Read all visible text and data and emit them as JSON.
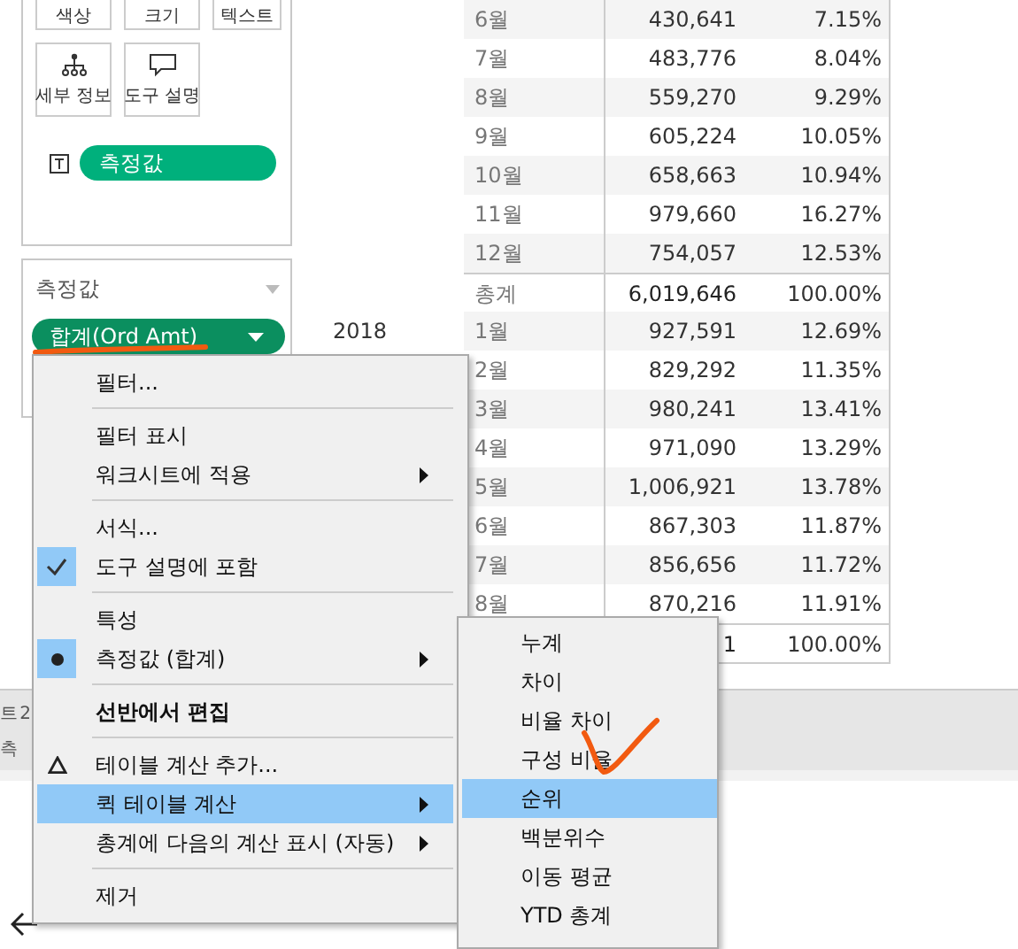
{
  "marks_card": {
    "buttons": [
      {
        "label": "색상",
        "kind": "plain"
      },
      {
        "label": "크기",
        "kind": "plain"
      },
      {
        "label": "텍스트",
        "kind": "plain"
      },
      {
        "label": "세부 정보",
        "kind": "detail"
      },
      {
        "label": "도구 설명",
        "kind": "tooltip"
      }
    ],
    "text_pill": "측정값"
  },
  "measure_values": {
    "title": "측정값",
    "pill": "합계(Ord Amt)"
  },
  "table": {
    "rows": [
      {
        "month": "6월",
        "value": "430,641",
        "percent": "7.15%"
      },
      {
        "month": "7월",
        "value": "483,776",
        "percent": "8.04%"
      },
      {
        "month": "8월",
        "value": "559,270",
        "percent": "9.29%"
      },
      {
        "month": "9월",
        "value": "605,224",
        "percent": "10.05%"
      },
      {
        "month": "10월",
        "value": "658,663",
        "percent": "10.94%"
      },
      {
        "month": "11월",
        "value": "979,660",
        "percent": "16.27%"
      },
      {
        "month": "12월",
        "value": "754,057",
        "percent": "12.53%"
      },
      {
        "month": "총계",
        "value": "6,019,646",
        "percent": "100.00%",
        "total": true
      },
      {
        "year": "2018",
        "month": "1월",
        "value": "927,591",
        "percent": "12.69%"
      },
      {
        "month": "2월",
        "value": "829,292",
        "percent": "11.35%"
      },
      {
        "month": "3월",
        "value": "980,241",
        "percent": "13.41%"
      },
      {
        "month": "4월",
        "value": "971,090",
        "percent": "13.29%"
      },
      {
        "month": "5월",
        "value": "1,006,921",
        "percent": "13.78%"
      },
      {
        "month": "6월",
        "value": "867,303",
        "percent": "11.87%"
      },
      {
        "month": "7월",
        "value": "856,656",
        "percent": "11.72%"
      },
      {
        "month": "8월",
        "value": "870,216",
        "percent": "11.91%"
      },
      {
        "value": "1",
        "percent": "100.00%",
        "total": true
      }
    ]
  },
  "sheet_tabs": [
    "트 2",
    "측"
  ],
  "context_menu": {
    "groups": [
      [
        {
          "label": "필터...",
          "selected": false,
          "submenu": false
        }
      ],
      [
        {
          "label": "필터 표시",
          "selected": false,
          "submenu": false
        },
        {
          "label": "워크시트에 적용",
          "selected": false,
          "submenu": true
        }
      ],
      [
        {
          "label": "서식...",
          "selected": false,
          "submenu": false
        },
        {
          "label": "도구 설명에 포함",
          "selected": false,
          "submenu": false,
          "kind": "check"
        }
      ],
      [
        {
          "label": "특성",
          "selected": false,
          "submenu": false
        },
        {
          "label": "측정값 (합계)",
          "selected": false,
          "submenu": true,
          "kind": "radio"
        }
      ],
      [
        {
          "label": "선반에서 편집",
          "selected": false,
          "submenu": false,
          "bold": true
        }
      ],
      [
        {
          "label": "테이블 계산 추가...",
          "selected": false,
          "submenu": false,
          "kind": "calc"
        },
        {
          "label": "퀵 테이블 계산",
          "selected": true,
          "submenu": true
        },
        {
          "label": "총계에 다음의 계산 표시 (자동)",
          "selected": false,
          "submenu": true
        }
      ],
      [
        {
          "label": "제거",
          "selected": false,
          "submenu": false
        }
      ]
    ]
  },
  "submenu": {
    "items": [
      {
        "label": "누계",
        "selected": false
      },
      {
        "label": "차이",
        "selected": false
      },
      {
        "label": "비율 차이",
        "selected": false
      },
      {
        "label": "구성 비율",
        "selected": false
      },
      {
        "label": "순위",
        "selected": true
      },
      {
        "label": "백분위수",
        "selected": false
      },
      {
        "label": "이동 평균",
        "selected": false
      },
      {
        "label": "YTD 총계",
        "selected": false
      }
    ]
  }
}
